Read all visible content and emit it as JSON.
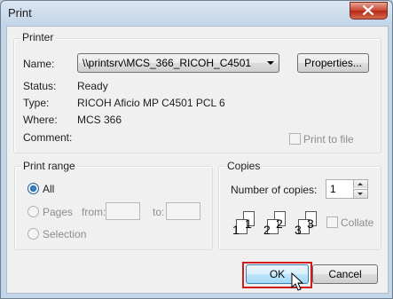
{
  "window": {
    "title": "Print"
  },
  "printer": {
    "group_label": "Printer",
    "name_label": "Name:",
    "name_value": "\\\\printsrv\\MCS_366_RICOH_C4501",
    "properties_button": "Properties...",
    "status_label": "Status:",
    "status_value": "Ready",
    "type_label": "Type:",
    "type_value": "RICOH Aficio MP C4501 PCL 6",
    "where_label": "Where:",
    "where_value": "MCS 366",
    "comment_label": "Comment:",
    "print_to_file_label": "Print to file"
  },
  "print_range": {
    "group_label": "Print range",
    "all_label": "All",
    "pages_label": "Pages",
    "from_label": "from:",
    "to_label": "to:",
    "selection_label": "Selection",
    "selected": "All"
  },
  "copies": {
    "group_label": "Copies",
    "number_label": "Number of copies:",
    "number_value": "1",
    "collate_label": "Collate",
    "collate_icon_numbers": [
      "1",
      "1",
      "2",
      "2",
      "3",
      "3"
    ]
  },
  "buttons": {
    "ok": "OK",
    "cancel": "Cancel"
  },
  "colors": {
    "highlight_box": "#d01c1c",
    "ok_focus": "#3c7fb1"
  },
  "icons": [
    "close-icon",
    "dropdown-arrow-icon",
    "spin-up-icon",
    "spin-down-icon",
    "collate-pages-icon",
    "mouse-cursor-icon"
  ]
}
